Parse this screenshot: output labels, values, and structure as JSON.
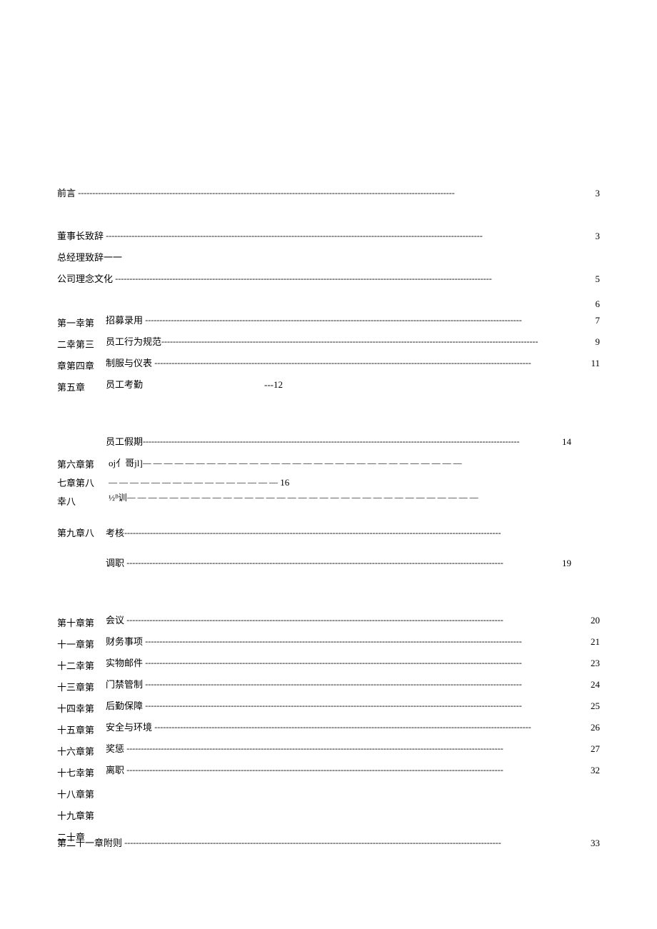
{
  "top": {
    "preface_label": "前言",
    "preface_page": "3",
    "chairman_label": "董事长致辞",
    "chairman_page": "3",
    "gm_label": "总经理致辞一一",
    "culture_label": "公司理念文化",
    "culture_page": "5"
  },
  "col1_chapters": "第一幸第二幸第三章第四章第五章",
  "sec1": {
    "p6": "6",
    "recruit_label": "招募录用",
    "recruit_page": "7",
    "conduct_label": "员工行为规范",
    "conduct_page": "9",
    "uniform_label": "制服与仪表",
    "uniform_page": "11",
    "attend_label": "员工考勤",
    "attend_mid": "---12"
  },
  "col2_chapters_a": "第六章第七章第八幸八",
  "col2_chapters_b": "第九章八",
  "sec2": {
    "leave_label": "员工假期",
    "leave_page": "14",
    "gibberish": "oj亻哥jl]",
    "gibberish_page": "16",
    "train_label": "½ᴮ训",
    "exam_label": "考核",
    "transfer_label": "调职",
    "transfer_page": "19"
  },
  "col3_chapters": "第十章第十一章第十二幸第十三章第十四幸第十五章第十六章第十七幸第十八章第十九章第二十章",
  "sec3": {
    "meeting_label": "会议",
    "meeting_page": "20",
    "finance_label": "财务事项",
    "finance_page": "21",
    "mail_label": "实物邮件",
    "mail_page": "23",
    "door_label": "门禁管制",
    "door_page": "24",
    "logistics_label": "后勤保障",
    "logistics_page": "25",
    "safety_label": "安全与环境",
    "safety_page": "26",
    "reward_label": "奖惩",
    "reward_page": "27",
    "resign_label": "离职",
    "resign_page": "32"
  },
  "appendix_label": "第二十一章附则",
  "appendix_page": "33",
  "dash_fill": "------------------------------------------------------------------------------------------------------------------------------------",
  "dash_fill_wide": "— — — — — — — — — — — — — — — — — — — — — — — — — — — — — —",
  "dash_fill_med": "— — — — — — — — — — — — — — — —",
  "dash_fill_train": "— — — — — — — — — — — — — — — — — — — — — — — — — — — — — — — — —"
}
